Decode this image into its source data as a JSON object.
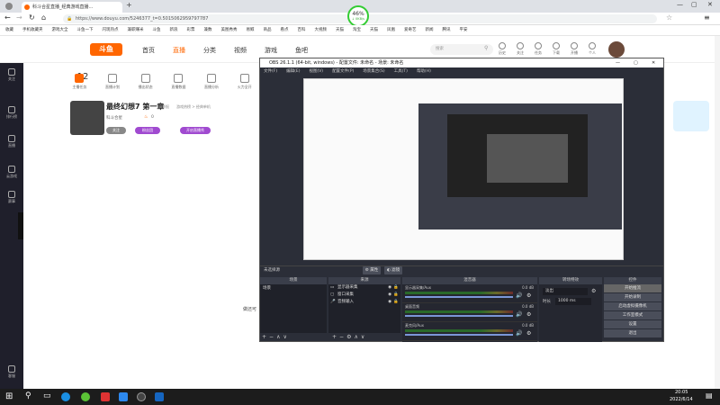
{
  "browser": {
    "tab_title": "科斗合星直播_经典游戏直播...",
    "url": "https://www.douyu.com/5246377_t=0.5015062959797787",
    "new_tab": "+",
    "bookmarks": [
      "收藏",
      "手机收藏夹",
      "游戏大全",
      "斗鱼一下",
      "闪现热点",
      "兼职赚米",
      "斗鱼",
      "新浪",
      "彩票",
      "兼数",
      "美图秀秀",
      "易鲸",
      "商品",
      "看点",
      "百科",
      "大视频",
      "天猫",
      "淘宝",
      "天猫",
      "凤凰",
      "爱奇艺",
      "新闻",
      "腾讯",
      "平安"
    ],
    "progress_percent": "46",
    "progress_sub": "↓ 0KB/s"
  },
  "site": {
    "logo": "斗鱼",
    "nav": [
      "首页",
      "直播",
      "分类",
      "视频",
      "游戏",
      "鱼吧"
    ],
    "search_placeholder": "搜索",
    "header_icons": [
      "历史",
      "关注",
      "任务",
      "下载",
      "开播",
      "个人"
    ]
  },
  "rail": {
    "items": [
      "关注",
      "排行榜",
      "直播",
      "云游戏",
      "赛事",
      "客服"
    ]
  },
  "reco": {
    "level": "12",
    "items": [
      "主播任务",
      "直播计划",
      "播出状态",
      "直播数据",
      "直播分析",
      "火力全开"
    ]
  },
  "room": {
    "title": "最终幻想7 第一章",
    "tag1": "举报",
    "tag2": "游戏热榜 > 经典单机",
    "host": "科斗合星",
    "followers": "0",
    "btn_follow": "关注",
    "btn_share": "粉丝团",
    "btn_gift": "开启直播秀"
  },
  "obs": {
    "title": "OBS 26.1.1 (64-bit, windows) - 配置文件: 未命名 - 场景: 未命名",
    "menu": [
      "文件(F)",
      "编辑(E)",
      "视图(V)",
      "配置文件(P)",
      "场景集合(S)",
      "工具(T)",
      "帮助(H)"
    ],
    "no_source": "未选择源",
    "prop_btn": "属性",
    "filter_btn": "滤镜",
    "scenes_hdr": "场景",
    "scene_item": "场景",
    "sources_hdr": "来源",
    "sources": [
      "显示器采集",
      "窗口采集",
      "音频输入"
    ],
    "mixer_hdr": "混音器",
    "mixer": [
      {
        "name": "显示器采集/Aux",
        "db": "0.0 dB"
      },
      {
        "name": "桌面音频",
        "db": "0.0 dB"
      },
      {
        "name": "麦克风/Aux",
        "db": "0.0 dB"
      }
    ],
    "transition_hdr": "转场特效",
    "transition_value": "淡出",
    "duration_label": "时长",
    "duration_value": "1000 ms",
    "controls_hdr": "控件",
    "controls": [
      "开始推流",
      "开始录制",
      "启动虚拟摄像机",
      "工作室模式",
      "设置",
      "退出"
    ]
  },
  "side_text": "做还可",
  "taskbar": {
    "time": "20:05",
    "date": "2022/6/14"
  }
}
